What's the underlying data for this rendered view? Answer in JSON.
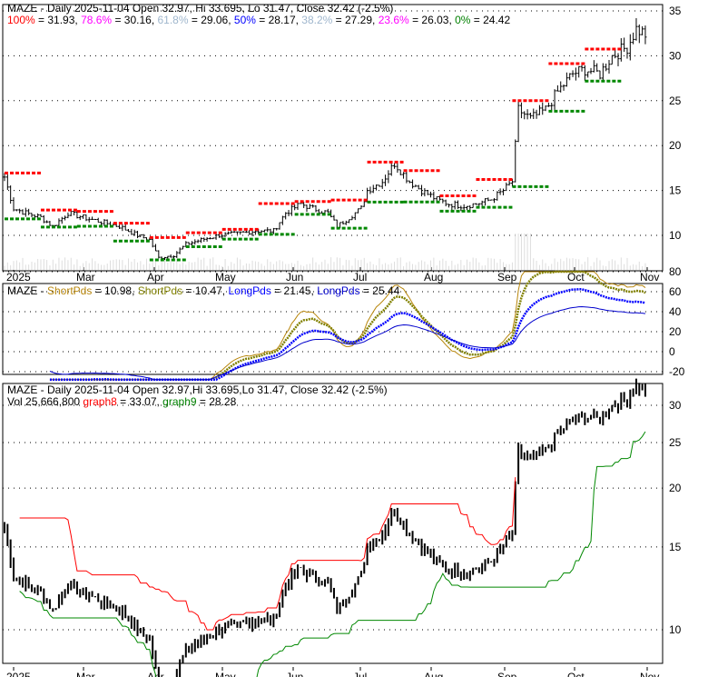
{
  "chart_data": [
    {
      "type": "candlestick",
      "title": "MAZE - Daily 2025-11-04 Open 32.97, Hi 33.695, Lo 31.47, Close 32.42 (-2.5%)",
      "fib": [
        {
          "label": "100%",
          "value": "31.93",
          "color": "#ff0000"
        },
        {
          "label": "78.6%",
          "value": "30.16",
          "color": "#ff00ff"
        },
        {
          "label": "61.8%",
          "value": "29.06",
          "color": "#9fb6cd"
        },
        {
          "label": "50%",
          "value": "28.17",
          "color": "#0000ff"
        },
        {
          "label": "38.2%",
          "value": "27.29",
          "color": "#9fb6cd"
        },
        {
          "label": "23.6%",
          "value": "26.03",
          "color": "#ff00ff"
        },
        {
          "label": "0%",
          "value": "24.42",
          "color": "#008000"
        }
      ],
      "yticks": [
        10,
        15,
        20,
        25,
        30,
        35
      ],
      "ylim": [
        6,
        36
      ]
    },
    {
      "type": "line",
      "title_prefix": "MAZE - ",
      "legend": [
        {
          "label": "ShortPds",
          "value": "10.98",
          "color": "#b8860b"
        },
        {
          "label": "ShortPds",
          "value": "10.47",
          "color": "#808000"
        },
        {
          "label": "LongPds",
          "value": "21.45",
          "color": "#0000ff"
        },
        {
          "label": "LongPds",
          "value": "25.44",
          "color": "#0000cd"
        }
      ],
      "yticks": [
        -20,
        0,
        20,
        40,
        60,
        80
      ],
      "ylim": [
        -30,
        85
      ]
    },
    {
      "type": "candlestick",
      "title": "MAZE - Daily 2025-11-04 Open 32.97,Hi 33.695,Lo 31.47, Close 32.42 (-2.5%)",
      "vol": "Vol 25,666,800",
      "legend": [
        {
          "label": "graph8",
          "value": "33.07",
          "color": "#ff0000"
        },
        {
          "label": "graph9",
          "value": "28.28",
          "color": "#008000"
        }
      ],
      "yticks": [
        10,
        15,
        20,
        25,
        30
      ]
    }
  ],
  "xticks": [
    "2025",
    "Mar",
    "Apr",
    "May",
    "Jun",
    "Jul",
    "Aug",
    "Sep",
    "Oct",
    "Nov"
  ],
  "close_points": [
    [
      0,
      16.5
    ],
    [
      3,
      13
    ],
    [
      7,
      12.5
    ],
    [
      12,
      12
    ],
    [
      16,
      11
    ],
    [
      21,
      12.5
    ],
    [
      26,
      12
    ],
    [
      32,
      11.5
    ],
    [
      38,
      11
    ],
    [
      44,
      10
    ],
    [
      48,
      9.5
    ],
    [
      51,
      7.5
    ],
    [
      56,
      7.8
    ],
    [
      60,
      9
    ],
    [
      65,
      9.5
    ],
    [
      71,
      10
    ],
    [
      77,
      10.2
    ],
    [
      83,
      10.5
    ],
    [
      89,
      10.5
    ],
    [
      93,
      12.5
    ],
    [
      98,
      13.5
    ],
    [
      102,
      13
    ],
    [
      107,
      12.5
    ],
    [
      110,
      11
    ],
    [
      114,
      12
    ],
    [
      118,
      13
    ],
    [
      120,
      15
    ],
    [
      125,
      16
    ],
    [
      129,
      18
    ],
    [
      134,
      16
    ],
    [
      138,
      15
    ],
    [
      143,
      14
    ],
    [
      147,
      13.5
    ],
    [
      152,
      13.3
    ],
    [
      156,
      13.5
    ],
    [
      161,
      14
    ],
    [
      165,
      15
    ],
    [
      168,
      16
    ],
    [
      170,
      24
    ],
    [
      174,
      23
    ],
    [
      179,
      24
    ],
    [
      183,
      26
    ],
    [
      188,
      28
    ],
    [
      192,
      28.5
    ],
    [
      197,
      28
    ],
    [
      201,
      30
    ],
    [
      206,
      31
    ],
    [
      209,
      33
    ],
    [
      212,
      32.4
    ]
  ]
}
